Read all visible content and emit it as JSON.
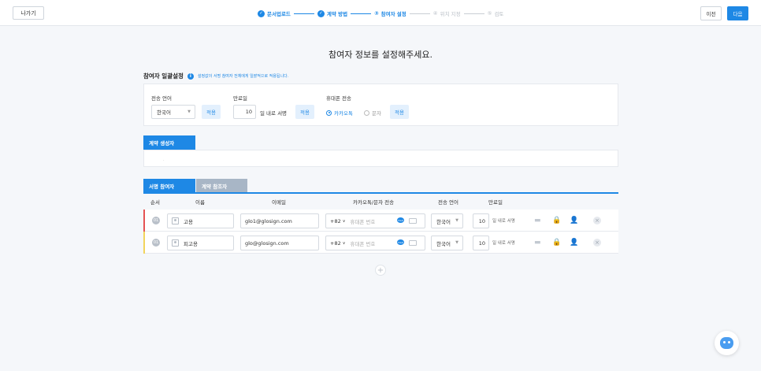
{
  "header": {
    "exit_label": "나가기",
    "prev_label": "이전",
    "next_label": "다음",
    "steps": [
      {
        "num": "✓",
        "label": "문서업로드",
        "state": "done"
      },
      {
        "num": "✓",
        "label": "계약 방법",
        "state": "done"
      },
      {
        "num": "③",
        "label": "참여자 설정",
        "state": "current"
      },
      {
        "num": "④",
        "label": "위치 지정",
        "state": "todo"
      },
      {
        "num": "⑤",
        "label": "검토",
        "state": "todo"
      }
    ]
  },
  "page_title": "참여자 정보를 설정해주세요.",
  "bulk": {
    "title": "참여자 일괄설정",
    "hint": "설정값이 서명 참여자 전체에게 일괄적으로 적용됩니다.",
    "language_label": "전송 언어",
    "language_value": "한국어",
    "expiry_label": "만료일",
    "expiry_value": "10",
    "expiry_suffix": "일 내로 서명",
    "phone_label": "휴대폰 전송",
    "opt_kakao": "카카오톡",
    "opt_sms": "문자",
    "apply_label": "적용"
  },
  "creator_tab": "계약 생성자",
  "creator_mark": "·",
  "tabs": {
    "signers": "서명 참여자",
    "viewers": "계약 참조자"
  },
  "table": {
    "headers": {
      "order": "순서",
      "name": "이름",
      "email": "이메일",
      "kakao": "카카오톡/문자 전송",
      "lang": "전송 언어",
      "expiry": "만료일"
    },
    "rows": [
      {
        "order": "01",
        "name": "고용",
        "email": "glo1@glosign.com",
        "code": "+82",
        "phone_ph": "휴대폰 번호",
        "lang": "한국어",
        "days": "10",
        "days_suffix": "일 내로 서명",
        "color": "#e55353"
      },
      {
        "order": "01",
        "name": "피고용",
        "email": "glo@glosign.com",
        "code": "+82",
        "phone_ph": "휴대폰 번호",
        "lang": "한국어",
        "days": "10",
        "days_suffix": "일 내로 서명",
        "color": "#f2d45c"
      }
    ]
  },
  "add_symbol": "+"
}
